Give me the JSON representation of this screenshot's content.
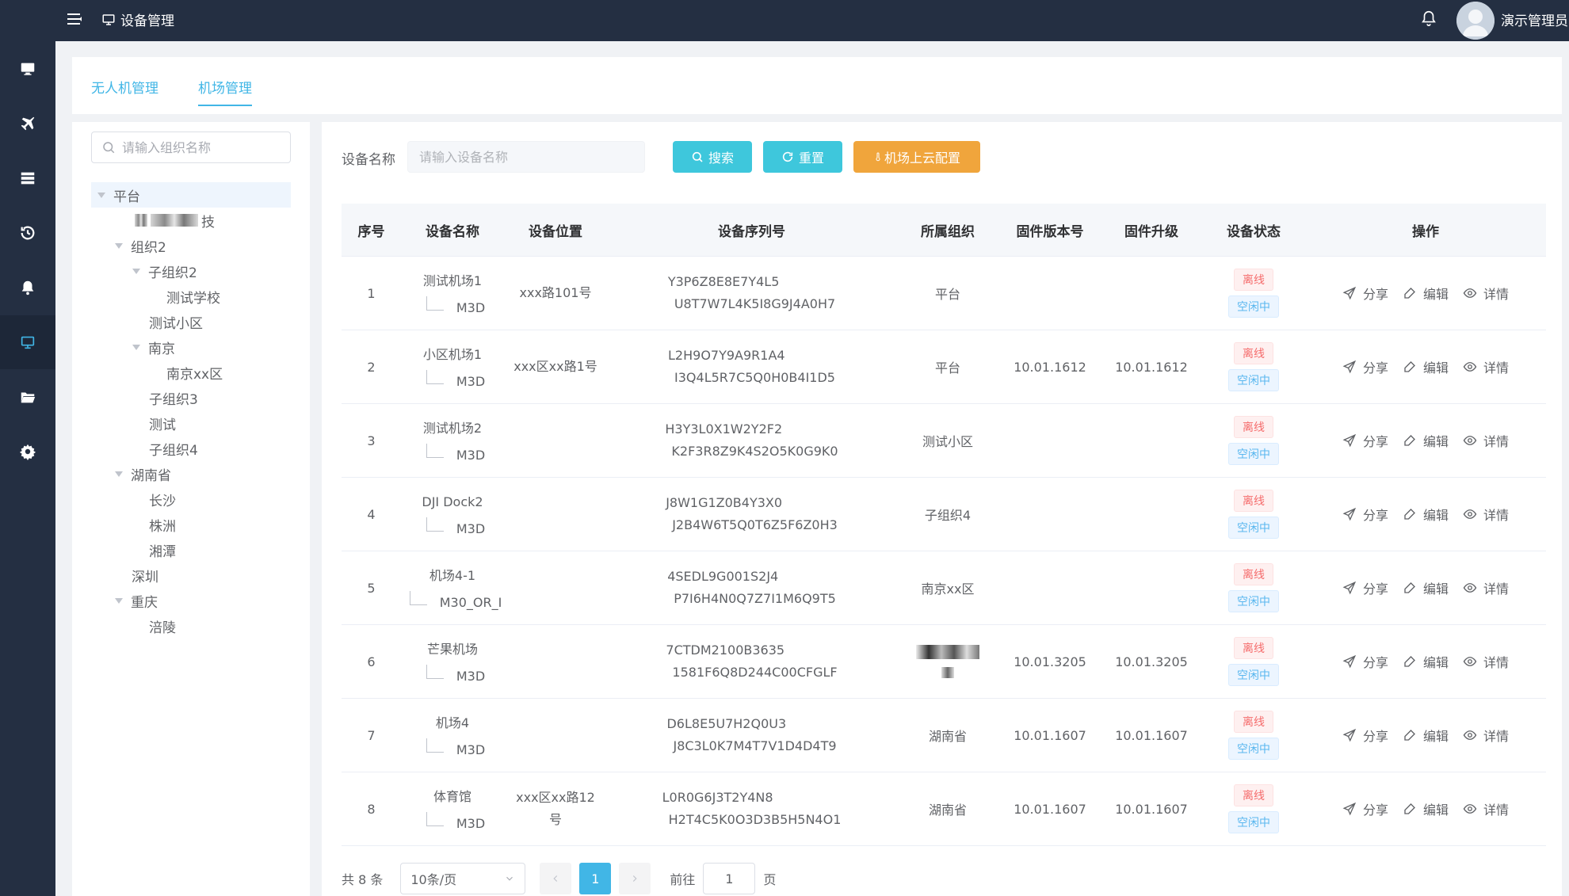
{
  "header": {
    "title": "设备管理",
    "user_name": "演示管理员"
  },
  "sidebar": {
    "items": [
      {
        "icon": "monitor-icon"
      },
      {
        "icon": "airplane-icon"
      },
      {
        "icon": "server-list-icon"
      },
      {
        "icon": "history-icon"
      },
      {
        "icon": "bell-icon"
      },
      {
        "icon": "screen-icon",
        "active": true
      },
      {
        "icon": "folder-icon"
      },
      {
        "icon": "gear-icon"
      }
    ]
  },
  "tabs": [
    {
      "label": "无人机管理",
      "active": false
    },
    {
      "label": "机场管理",
      "active": true
    }
  ],
  "tree": {
    "placeholder": "请输入组织名称",
    "nodes": [
      {
        "label": "平台",
        "level": 0,
        "caret": true
      },
      {
        "label": "技",
        "level": 1,
        "caret": false,
        "blurred": true
      },
      {
        "label": "组织2",
        "level": 1,
        "caret": true
      },
      {
        "label": "子组织2",
        "level": 2,
        "caret": true
      },
      {
        "label": "测试学校",
        "level": 3,
        "caret": false
      },
      {
        "label": "测试小区",
        "level": 2,
        "caret": false
      },
      {
        "label": "南京",
        "level": 2,
        "caret": true
      },
      {
        "label": "南京xx区",
        "level": 3,
        "caret": false
      },
      {
        "label": "子组织3",
        "level": 2,
        "caret": false
      },
      {
        "label": "测试",
        "level": 2,
        "caret": false
      },
      {
        "label": "子组织4",
        "level": 2,
        "caret": false
      },
      {
        "label": "湖南省",
        "level": 1,
        "caret": true
      },
      {
        "label": "长沙",
        "level": 2,
        "caret": false
      },
      {
        "label": "株洲",
        "level": 2,
        "caret": false
      },
      {
        "label": "湘潭",
        "level": 2,
        "caret": false
      },
      {
        "label": "深圳",
        "level": 1,
        "caret": false
      },
      {
        "label": "重庆",
        "level": 1,
        "caret": true
      },
      {
        "label": "涪陵",
        "level": 2,
        "caret": false
      }
    ]
  },
  "filter": {
    "label": "设备名称",
    "placeholder": "请输入设备名称",
    "search_label": "搜索",
    "reset_label": "重置",
    "cloud_label": "机场上云配置"
  },
  "table": {
    "headers": [
      "序号",
      "设备名称",
      "设备位置",
      "设备序列号",
      "所属组织",
      "固件版本号",
      "固件升级",
      "设备状态",
      "操作"
    ],
    "status_offline": "离线",
    "status_idle": "空闲中",
    "op_share": "分享",
    "op_edit": "编辑",
    "op_detail": "详情",
    "rows": [
      {
        "no": "1",
        "name": "测试机场1",
        "child": "M3D",
        "location": "xxx路101号",
        "serial1": "Y3P6Z8E8E7Y4L5",
        "serial2": "U8T7W7L4K5I8G9J4A0H7",
        "org": "平台",
        "firmware": "",
        "upgrade": ""
      },
      {
        "no": "2",
        "name": "小区机场1",
        "child": "M3D",
        "location": "xxx区xx路1号",
        "serial1": "L2H9O7Y9A9R1A4",
        "serial2": "I3Q4L5R7C5Q0H0B4I1D5",
        "org": "平台",
        "firmware": "10.01.1612",
        "upgrade": "10.01.1612"
      },
      {
        "no": "3",
        "name": "测试机场2",
        "child": "M3D",
        "location": "",
        "serial1": "H3Y3L0X1W2Y2F2",
        "serial2": "K2F3R8Z9K4S2O5K0G9K0",
        "org": "测试小区",
        "firmware": "",
        "upgrade": ""
      },
      {
        "no": "4",
        "name": "DJI Dock2",
        "child": "M3D",
        "location": "",
        "serial1": "J8W1G1Z0B4Y3X0",
        "serial2": "J2B4W6T5Q0T6Z5F6Z0H3",
        "org": "子组织4",
        "firmware": "",
        "upgrade": ""
      },
      {
        "no": "5",
        "name": "机场4-1",
        "child": "M30_OR_I",
        "location": "",
        "serial1": "4SEDL9G001S2J4",
        "serial2": "P7I6H4N0Q7Z7I1M6Q9T5",
        "org": "南京xx区",
        "firmware": "",
        "upgrade": ""
      },
      {
        "no": "6",
        "name": "芒果机场",
        "child": "M3D",
        "location": "",
        "serial1": "7CTDM2100B3635",
        "serial2": "1581F6Q8D244C00CFGLF",
        "org": "",
        "org_blurred": true,
        "firmware": "10.01.3205",
        "upgrade": "10.01.3205"
      },
      {
        "no": "7",
        "name": "机场4",
        "child": "M3D",
        "location": "",
        "serial1": "D6L8E5U7H2Q0U3",
        "serial2": "J8C3L0K7M4T7V1D4D4T9",
        "org": "湖南省",
        "firmware": "10.01.1607",
        "upgrade": "10.01.1607"
      },
      {
        "no": "8",
        "name": "体育馆",
        "child": "M3D",
        "location": "xxx区xx路12号",
        "serial1": "L0R0G6J3T2Y4N8",
        "serial2": "H2T4C5K0O3D3B5H5N4O1",
        "org": "湖南省",
        "firmware": "10.01.1607",
        "upgrade": "10.01.1607"
      }
    ]
  },
  "pager": {
    "total": "共 8 条",
    "page_size": "10条/页",
    "current": "1",
    "goto_label": "前往",
    "goto_value": "1",
    "page_suffix": "页"
  }
}
